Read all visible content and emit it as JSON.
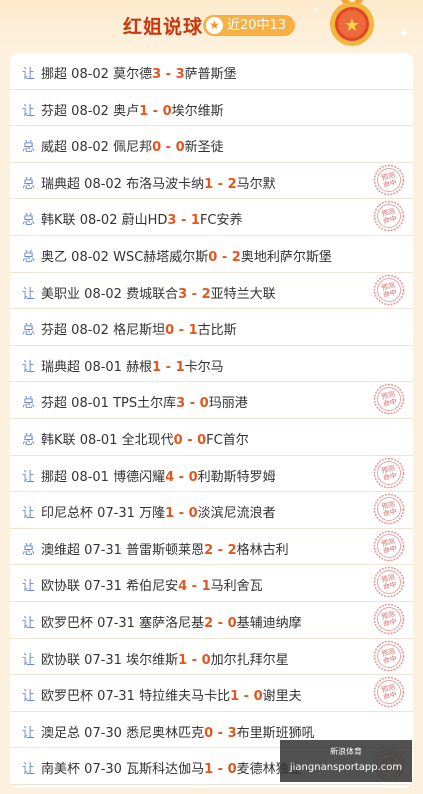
{
  "header": {
    "title": "红姐说球",
    "badge": "近20中13"
  },
  "stamp_text": "预测命中",
  "watermark": {
    "line1": "新浪体育",
    "line2": "jiangnansportapp.com"
  },
  "rows": [
    {
      "tag": "让",
      "league": "挪超",
      "date": "08-02",
      "home": "莫尔德",
      "hs": "3",
      "as": "3",
      "away": "萨普斯堡",
      "hit": false
    },
    {
      "tag": "让",
      "league": "芬超",
      "date": "08-02",
      "home": "奥卢",
      "hs": "1",
      "as": "0",
      "away": "埃尔维斯",
      "hit": false
    },
    {
      "tag": "总",
      "league": "威超",
      "date": "08-02",
      "home": "佩尼邦",
      "hs": "0",
      "as": "0",
      "away": "新圣徒",
      "hit": false
    },
    {
      "tag": "总",
      "league": "瑞典超",
      "date": "08-02",
      "home": "布洛马波卡纳",
      "hs": "1",
      "as": "2",
      "away": "马尔默",
      "hit": true
    },
    {
      "tag": "总",
      "league": "韩K联",
      "date": "08-02",
      "home": "蔚山HD",
      "hs": "3",
      "as": "1",
      "away": "FC安养",
      "hit": true
    },
    {
      "tag": "总",
      "league": "奥乙",
      "date": "08-02",
      "home": "WSC赫塔威尔斯",
      "hs": "0",
      "as": "2",
      "away": "奥地利萨尔斯堡",
      "hit": false
    },
    {
      "tag": "让",
      "league": "美职业",
      "date": "08-02",
      "home": "费城联合",
      "hs": "3",
      "as": "2",
      "away": "亚特兰大联",
      "hit": true
    },
    {
      "tag": "总",
      "league": "芬超",
      "date": "08-02",
      "home": "格尼斯坦",
      "hs": "0",
      "as": "1",
      "away": "古比斯",
      "hit": false
    },
    {
      "tag": "让",
      "league": "瑞典超",
      "date": "08-01",
      "home": "赫根",
      "hs": "1",
      "as": "1",
      "away": "卡尔马",
      "hit": false
    },
    {
      "tag": "总",
      "league": "芬超",
      "date": "08-01",
      "home": "TPS土尔库",
      "hs": "3",
      "as": "0",
      "away": "玛丽港",
      "hit": true
    },
    {
      "tag": "总",
      "league": "韩K联",
      "date": "08-01",
      "home": "全北现代",
      "hs": "0",
      "as": "0",
      "away": "FC首尔",
      "hit": false
    },
    {
      "tag": "让",
      "league": "挪超",
      "date": "08-01",
      "home": "博德闪耀",
      "hs": "4",
      "as": "0",
      "away": "利勒斯特罗姆",
      "hit": true
    },
    {
      "tag": "让",
      "league": "印尼总杯",
      "date": "07-31",
      "home": "万隆",
      "hs": "1",
      "as": "0",
      "away": "淡滨尼流浪者",
      "hit": true
    },
    {
      "tag": "总",
      "league": "澳维超",
      "date": "07-31",
      "home": "普雷斯顿莱恩",
      "hs": "2",
      "as": "2",
      "away": "格林古利",
      "hit": true
    },
    {
      "tag": "让",
      "league": "欧协联",
      "date": "07-31",
      "home": "希伯尼安",
      "hs": "4",
      "as": "1",
      "away": "马利舍瓦",
      "hit": true
    },
    {
      "tag": "让",
      "league": "欧罗巴杯",
      "date": "07-31",
      "home": "塞萨洛尼基",
      "hs": "2",
      "as": "0",
      "away": "基辅迪纳摩",
      "hit": true
    },
    {
      "tag": "让",
      "league": "欧协联",
      "date": "07-31",
      "home": "埃尔维斯",
      "hs": "1",
      "as": "0",
      "away": "加尔扎拜尔星",
      "hit": true
    },
    {
      "tag": "让",
      "league": "欧罗巴杯",
      "date": "07-31",
      "home": "特拉维夫马卡比",
      "hs": "1",
      "as": "0",
      "away": "谢里夫",
      "hit": true
    },
    {
      "tag": "让",
      "league": "澳足总",
      "date": "07-30",
      "home": "悉尼奥林匹克",
      "hs": "0",
      "as": "3",
      "away": "布里斯班狮吼",
      "hit": false
    },
    {
      "tag": "让",
      "league": "南美杯",
      "date": "07-30",
      "home": "瓦斯科达伽马",
      "hs": "1",
      "as": "0",
      "away": "麦德林独立",
      "hit": true
    }
  ]
}
